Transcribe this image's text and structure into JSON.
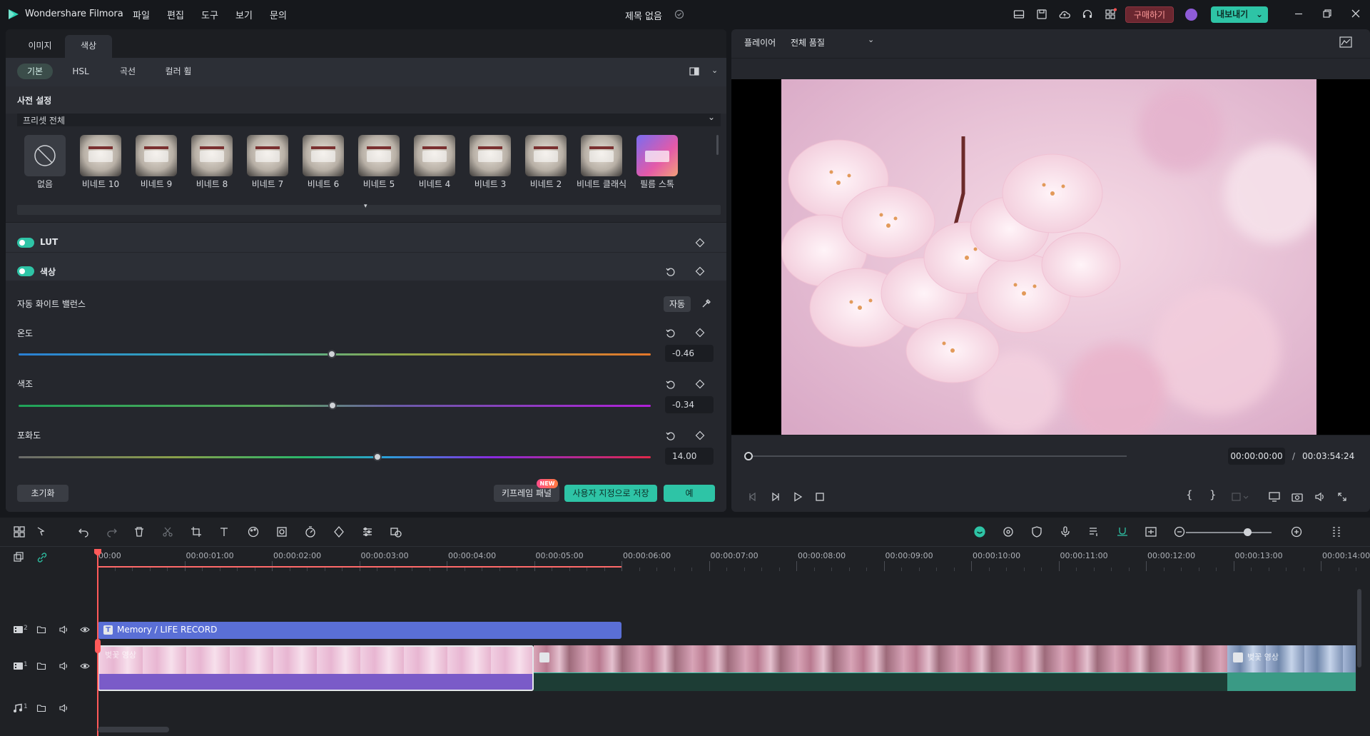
{
  "app": {
    "name": "Wondershare Filmora",
    "project_title": "제목 없음",
    "menu": [
      "파일",
      "편집",
      "도구",
      "보기",
      "문의"
    ],
    "buy_label": "구매하기",
    "export_label": "내보내기"
  },
  "left_panel": {
    "tabs": [
      "이미지",
      "색상"
    ],
    "active_tab": "색상",
    "subtabs": [
      "기본",
      "HSL",
      "곡선",
      "컬러 휠"
    ],
    "active_subtab": "기본",
    "preset_section_title": "사전 설정",
    "preset_dropdown": "프리셋 전체",
    "presets": [
      {
        "label": "없음",
        "icon": "none-icon"
      },
      {
        "label": "비네트 10"
      },
      {
        "label": "비네트 9"
      },
      {
        "label": "비네트 8"
      },
      {
        "label": "비네트 7"
      },
      {
        "label": "비네트 6"
      },
      {
        "label": "비네트 5"
      },
      {
        "label": "비네트 4"
      },
      {
        "label": "비네트 3"
      },
      {
        "label": "비네트 2"
      },
      {
        "label": "비네트 클래식"
      },
      {
        "label": "필름 스톡"
      }
    ],
    "lut": {
      "label": "LUT",
      "enabled": true
    },
    "color": {
      "label": "색상",
      "enabled": true
    },
    "awb": {
      "label": "자동 화이트 밸런스",
      "auto_label": "자동"
    },
    "sliders": [
      {
        "label": "온도",
        "value": "-0.46",
        "fraction": 0.495
      },
      {
        "label": "색조",
        "value": "-0.34",
        "fraction": 0.497
      },
      {
        "label": "포화도",
        "value": "14.00",
        "fraction": 0.568
      }
    ],
    "footer": {
      "reset_label": "초기화",
      "keyframe_label": "키프레임 패널",
      "new_badge": "NEW",
      "save_custom_label": "사용자 지정으로 저장",
      "ok_label": "예"
    }
  },
  "player": {
    "label": "플레이어",
    "quality": "전체 품질",
    "current_time": "00:00:00:00",
    "separator": "/",
    "total_time": "00:03:54:24"
  },
  "timeline": {
    "ruler": [
      "00:00",
      "00:00:01:00",
      "00:00:02:00",
      "00:00:03:00",
      "00:00:04:00",
      "00:00:05:00",
      "00:00:06:00",
      "00:00:07:00",
      "00:00:08:00",
      "00:00:09:00",
      "00:00:10:00",
      "00:00:11:00",
      "00:00:12:00",
      "00:00:13:00",
      "00:00:14:00"
    ],
    "tracks": [
      {
        "label": "2",
        "type": "video"
      },
      {
        "label": "1",
        "type": "video"
      },
      {
        "label": "1",
        "type": "audio"
      }
    ],
    "title_clip": "Memory / LIFE RECORD",
    "clip_label_1": "벚꽃 영상",
    "clip_label_2": "벚꽃 영상",
    "zoom_fraction": 0.72
  },
  "colors": {
    "accent": "#2ec4a6",
    "buy": "#c0392b",
    "playhead": "#ff5a5a",
    "title_clip": "#5a6fd6",
    "selected_clip": "#7a5bc8"
  }
}
